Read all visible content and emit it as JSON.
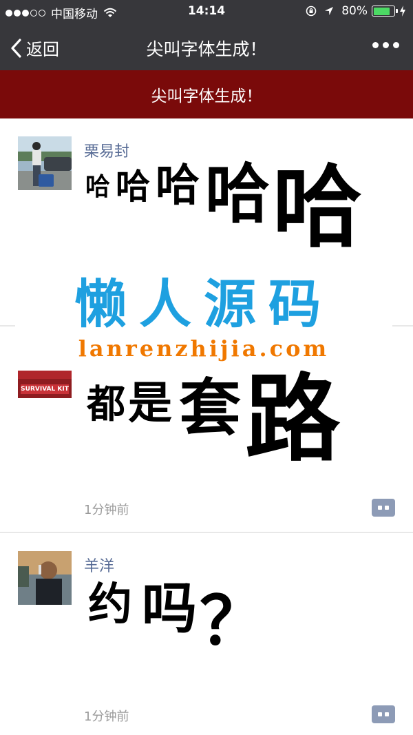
{
  "status_bar": {
    "carrier": "中国移动",
    "time": "14:14",
    "battery": "80%",
    "battery_level": 0.8,
    "icons": [
      "signal-dots-icon",
      "wifi-icon",
      "screen-rotation-lock-icon",
      "location-arrow-icon",
      "battery-icon",
      "charging-bolt-icon"
    ]
  },
  "nav": {
    "back_label": "返回",
    "title": "尖叫字体生成！",
    "more_icon": "more-dots-icon"
  },
  "banner": {
    "text": "尖叫字体生成！"
  },
  "posts": [
    {
      "user": "栗易封",
      "words": [
        "哈",
        "哈",
        "哈",
        "哈",
        "哈"
      ],
      "time": "",
      "avatar_icon": "photo-avatar"
    },
    {
      "user": "",
      "words": [
        "都",
        "是",
        "套",
        "路"
      ],
      "time": "1分钟前",
      "avatar_icon": "photo-avatar",
      "avatar_caption": "SURVIVAL KIT"
    },
    {
      "user": "羊洋",
      "words": [
        "约",
        "吗",
        "？"
      ],
      "time": "1分钟前",
      "avatar_icon": "photo-avatar"
    }
  ],
  "watermark": {
    "chinese": "懒人源码",
    "url": "lanrenzhijia.com"
  },
  "colors": {
    "bar_bg": "#37373b",
    "banner_bg": "#7a0a0a",
    "username": "#576b95",
    "watermark_cn": "#1ea0e0",
    "watermark_en": "#f07800"
  }
}
